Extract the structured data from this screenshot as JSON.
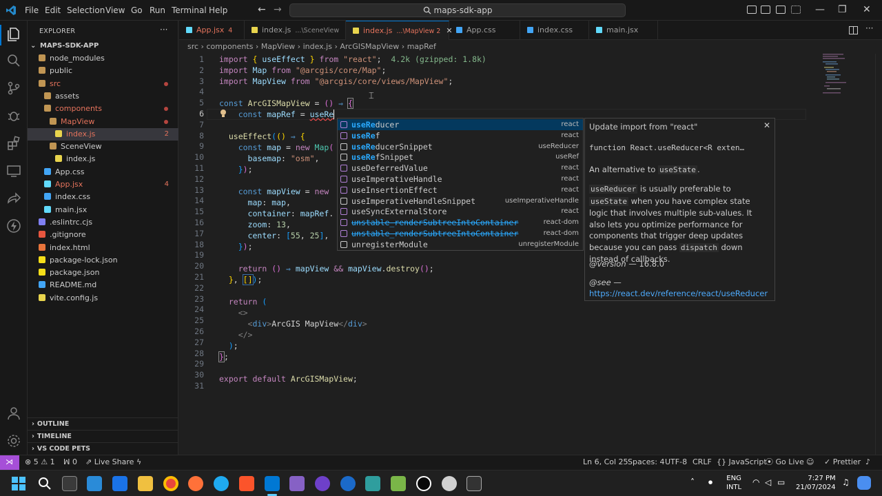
{
  "titlebar": {
    "menus": [
      "File",
      "Edit",
      "Selection",
      "View",
      "Go",
      "Run",
      "Terminal",
      "Help"
    ],
    "search": "maps-sdk-app",
    "window_controls": [
      "minimize-icon",
      "restore-icon",
      "close-icon"
    ]
  },
  "sidebar": {
    "title": "EXPLORER",
    "more": "···",
    "project": "MAPS-SDK-APP",
    "items": [
      {
        "label": "node_modules",
        "depth": 1,
        "type": "folder"
      },
      {
        "label": "public",
        "depth": 1,
        "type": "folder"
      },
      {
        "label": "src",
        "depth": 1,
        "type": "folder-open",
        "color": "#e5735c"
      },
      {
        "label": "assets",
        "depth": 2,
        "type": "folder"
      },
      {
        "label": "components",
        "depth": 2,
        "type": "folder-open",
        "color": "#e5735c"
      },
      {
        "label": "MapView",
        "depth": 3,
        "type": "folder-open",
        "color": "#e5735c"
      },
      {
        "label": "index.js",
        "depth": 4,
        "type": "js",
        "color": "#e5735c",
        "badge": "2",
        "selected": true
      },
      {
        "label": "SceneView",
        "depth": 3,
        "type": "folder"
      },
      {
        "label": "index.js",
        "depth": 4,
        "type": "js"
      },
      {
        "label": "App.css",
        "depth": 2,
        "type": "css"
      },
      {
        "label": "App.jsx",
        "depth": 2,
        "type": "react",
        "color": "#e5735c",
        "badge": "4"
      },
      {
        "label": "index.css",
        "depth": 2,
        "type": "css"
      },
      {
        "label": "main.jsx",
        "depth": 2,
        "type": "react"
      },
      {
        "label": ".eslintrc.cjs",
        "depth": 1,
        "type": "eslint"
      },
      {
        "label": ".gitignore",
        "depth": 1,
        "type": "git"
      },
      {
        "label": "index.html",
        "depth": 1,
        "type": "html"
      },
      {
        "label": "package-lock.json",
        "depth": 1,
        "type": "json"
      },
      {
        "label": "package.json",
        "depth": 1,
        "type": "json"
      },
      {
        "label": "README.md",
        "depth": 1,
        "type": "info"
      },
      {
        "label": "vite.config.js",
        "depth": 1,
        "type": "js"
      }
    ],
    "sections": [
      "OUTLINE",
      "TIMELINE",
      "VS CODE PETS"
    ]
  },
  "tabs": [
    {
      "label": "App.jsx",
      "extra": "4",
      "color": "#e5735c"
    },
    {
      "label": "index.js",
      "extra": "...\\SceneView"
    },
    {
      "label": "index.js",
      "extra": "...\\MapView 2",
      "active": true,
      "color": "#e5735c"
    },
    {
      "label": "App.css",
      "extra": ""
    },
    {
      "label": "index.css",
      "extra": ""
    },
    {
      "label": "main.jsx",
      "extra": ""
    }
  ],
  "breadcrumbs": [
    "src",
    "components",
    "MapView",
    "index.js",
    "ArcGISMapView",
    "mapRef"
  ],
  "cursor_line": 6,
  "suggest": [
    {
      "hl": "useRe",
      "rest": "ducer",
      "src": "react",
      "selected": true
    },
    {
      "hl": "useRe",
      "rest": "f",
      "src": "react"
    },
    {
      "hl": "useRe",
      "rest": "ducerSnippet",
      "src": "useReducer"
    },
    {
      "hl": "useRe",
      "rest": "fSnippet",
      "src": "useRef"
    },
    {
      "hl": "useDeferredValue",
      "rest": "",
      "src": "react"
    },
    {
      "hl": "useImperativeHandle",
      "rest": "",
      "src": "react"
    },
    {
      "hl": "useInsertionEffect",
      "rest": "",
      "src": "react"
    },
    {
      "hl": "useImperativeHandleSnippet",
      "rest": "",
      "src": "useImperativeHandle"
    },
    {
      "hl": "useSyncExternalStore",
      "rest": "",
      "src": "react"
    },
    {
      "hl": "unstable_renderSubtreeIntoContainer",
      "rest": "",
      "src": "react-dom",
      "strike": true
    },
    {
      "hl": "unstable_renderSubtreeIntoContainer",
      "rest": "",
      "src": "react-dom",
      "strike": true
    },
    {
      "hl": "unregisterModule",
      "rest": "",
      "src": "unregisterModule"
    }
  ],
  "details": {
    "header": "Update import from \"react\"",
    "signature": "function React.useReducer<R exten…",
    "p1_pre": "An alternative to ",
    "p1_code": "useState",
    "p1_post": ".",
    "p2_code1": "useReducer",
    "p2_mid": " is usually preferable to ",
    "p2_code2": "useState",
    "p2_text": " when you have complex state logic that involves multiple sub-values. It also lets you optimize performance for components that trigger deep updates because you can pass ",
    "p2_code3": "dispatch",
    "p2_end": " down instead of callbacks.",
    "version_label": "@version",
    "version": " — 16.8.0",
    "see_label": "@see",
    "see_dash": " —",
    "link": "https://react.dev/reference/react/useReducer"
  },
  "status": {
    "errors": "5",
    "warnings": "1",
    "ports": "0",
    "live_share": "Live Share",
    "position": "Ln 6, Col 25",
    "spaces": "Spaces: 4",
    "encoding": "UTF-8",
    "eol": "CRLF",
    "language": "JavaScript",
    "golive": "Go Live",
    "prettier": "Prettier"
  },
  "taskbar": {
    "lang1": "ENG",
    "lang2": "INTL",
    "time": "7:27 PM",
    "date": "21/07/2024"
  }
}
